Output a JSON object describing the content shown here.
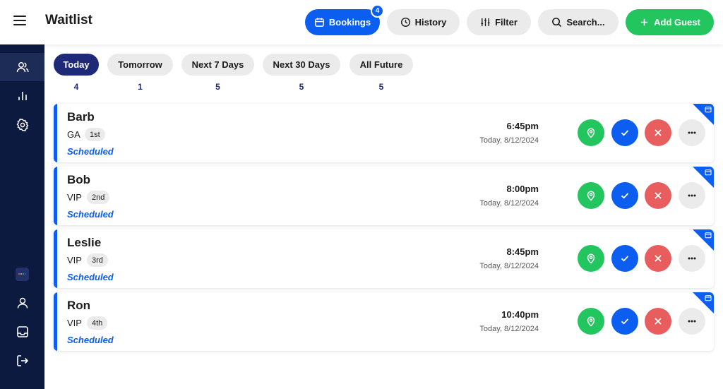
{
  "header": {
    "title": "Waitlist",
    "bookings_label": "Bookings",
    "bookings_count": "4",
    "history_label": "History",
    "filter_label": "Filter",
    "search_label": "Search...",
    "add_label": "Add Guest"
  },
  "sidebar": {
    "top_items": [
      "users-icon",
      "chart-icon",
      "settings-icon"
    ],
    "bottom_items": [
      "app-logo",
      "profile-icon",
      "inbox-icon",
      "logout-icon"
    ]
  },
  "tabs": [
    {
      "label": "Today",
      "count": "4"
    },
    {
      "label": "Tomorrow",
      "count": "1"
    },
    {
      "label": "Next 7 Days",
      "count": "5"
    },
    {
      "label": "Next 30 Days",
      "count": "5"
    },
    {
      "label": "All Future",
      "count": "5"
    }
  ],
  "guests": [
    {
      "name": "Barb",
      "tier": "GA",
      "position": "1st",
      "status": "Scheduled",
      "time": "6:45pm",
      "date": "Today, 8/12/2024"
    },
    {
      "name": "Bob",
      "tier": "VIP",
      "position": "2nd",
      "status": "Scheduled",
      "time": "8:00pm",
      "date": "Today, 8/12/2024"
    },
    {
      "name": "Leslie",
      "tier": "VIP",
      "position": "3rd",
      "status": "Scheduled",
      "time": "8:45pm",
      "date": "Today, 8/12/2024"
    },
    {
      "name": "Ron",
      "tier": "VIP",
      "position": "4th",
      "status": "Scheduled",
      "time": "10:40pm",
      "date": "Today, 8/12/2024"
    }
  ],
  "colors": {
    "primary": "#0b5ef0",
    "success": "#22c55e",
    "danger": "#e85d5d",
    "sidebar": "#0b1a3e",
    "active_tab": "#1e2a78"
  }
}
